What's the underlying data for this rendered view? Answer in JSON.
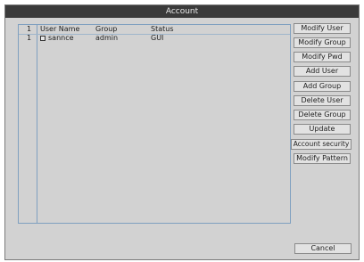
{
  "window": {
    "title": "Account"
  },
  "table": {
    "columns": [
      "1",
      "User Name",
      "Group",
      "Status"
    ],
    "rows": [
      {
        "index": "1",
        "user": "sannce",
        "group": "admin",
        "status": "GUI"
      }
    ]
  },
  "buttons": {
    "modify_user": "Modify User",
    "modify_group": "Modify Group",
    "modify_pwd": "Modify Pwd",
    "add_user": "Add User",
    "add_group": "Add Group",
    "delete_user": "Delete User",
    "delete_group": "Delete Group",
    "update": "Update",
    "account_security": "Account security",
    "modify_pattern": "Modify Pattern",
    "cancel": "Cancel"
  }
}
